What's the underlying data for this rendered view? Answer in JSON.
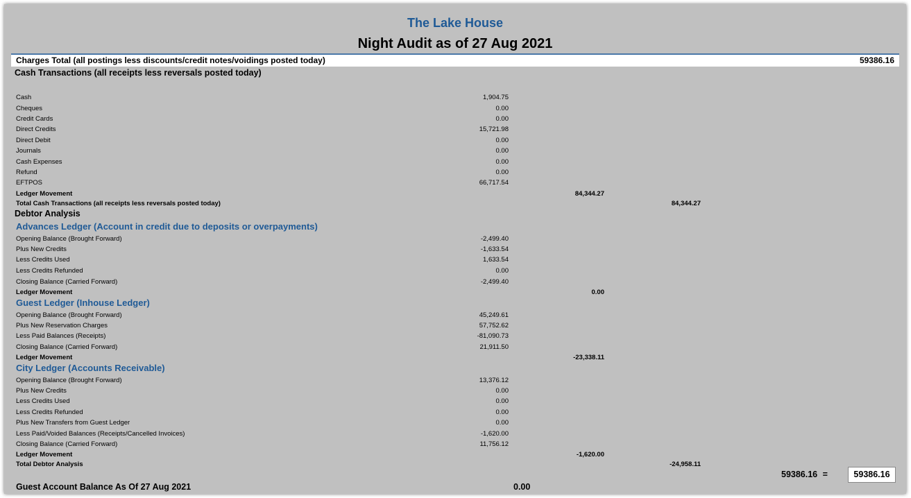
{
  "header": {
    "hotel_name": "The Lake House",
    "report_title": "Night Audit as of 27 Aug 2021"
  },
  "charges": {
    "label": "Charges Total (all postings less discounts/credit notes/voidings posted today)",
    "value": "59386.16"
  },
  "cash": {
    "title": "Cash Transactions (all receipts less reversals posted today)",
    "rows": [
      {
        "label": "Cash",
        "value": "1,904.75"
      },
      {
        "label": "Cheques",
        "value": "0.00"
      },
      {
        "label": "Credit Cards",
        "value": "0.00"
      },
      {
        "label": "Direct Credits",
        "value": "15,721.98"
      },
      {
        "label": "Direct Debit",
        "value": "0.00"
      },
      {
        "label": "Journals",
        "value": "0.00"
      },
      {
        "label": "Cash Expenses",
        "value": "0.00"
      },
      {
        "label": "Refund",
        "value": "0.00"
      },
      {
        "label": "EFTPOS",
        "value": "66,717.54"
      }
    ],
    "ledger_movement_label": "Ledger Movement",
    "ledger_movement_value": "84,344.27",
    "total_label": "Total Cash Transactions (all receipts less reversals posted today)",
    "total_value": "84,344.27"
  },
  "debtor": {
    "title": "Debtor Analysis",
    "advances": {
      "title": "Advances Ledger (Account in credit due to deposits or overpayments)",
      "rows": [
        {
          "label": "Opening Balance (Brought Forward)",
          "value": "-2,499.40"
        },
        {
          "label": "Plus New Credits",
          "value": "-1,633.54"
        },
        {
          "label": "Less Credits Used",
          "value": "1,633.54"
        },
        {
          "label": "Less Credits Refunded",
          "value": "0.00"
        },
        {
          "label": "Closing Balance (Carried Forward)",
          "value": "-2,499.40"
        }
      ],
      "ledger_movement_label": "Ledger Movement",
      "ledger_movement_value": "0.00"
    },
    "guest": {
      "title": "Guest Ledger (Inhouse Ledger)",
      "rows": [
        {
          "label": "Opening Balance (Brought Forward)",
          "value": "45,249.61"
        },
        {
          "label": "Plus New Reservation Charges",
          "value": "57,752.62"
        },
        {
          "label": "Less Paid Balances (Receipts)",
          "value": "-81,090.73"
        },
        {
          "label": "Closing Balance (Carried Forward)",
          "value": "21,911.50"
        }
      ],
      "ledger_movement_label": "Ledger Movement",
      "ledger_movement_value": "-23,338.11"
    },
    "city": {
      "title": "City Ledger (Accounts Receivable)",
      "rows": [
        {
          "label": "Opening Balance (Brought Forward)",
          "value": "13,376.12"
        },
        {
          "label": "Plus New Credits",
          "value": "0.00"
        },
        {
          "label": "Less Credits Used",
          "value": "0.00"
        },
        {
          "label": "Less Credits Refunded",
          "value": "0.00"
        },
        {
          "label": "Plus New Transfers from Guest Ledger",
          "value": "0.00"
        },
        {
          "label": "Less Paid/Voided Balances (Receipts/Cancelled Invoices)",
          "value": "-1,620.00"
        },
        {
          "label": "Closing Balance (Carried Forward)",
          "value": "11,756.12"
        }
      ],
      "ledger_movement_label": "Ledger Movement",
      "ledger_movement_value": "-1,620.00"
    },
    "total_label": "Total Debtor Analysis",
    "total_value": "-24,958.11"
  },
  "reconciliation": {
    "left_value": "59386.16",
    "equals": "=",
    "right_value": "59386.16"
  },
  "guest_balance": {
    "label": "Guest Account Balance As Of 27 Aug 2021",
    "value": "0.00"
  }
}
